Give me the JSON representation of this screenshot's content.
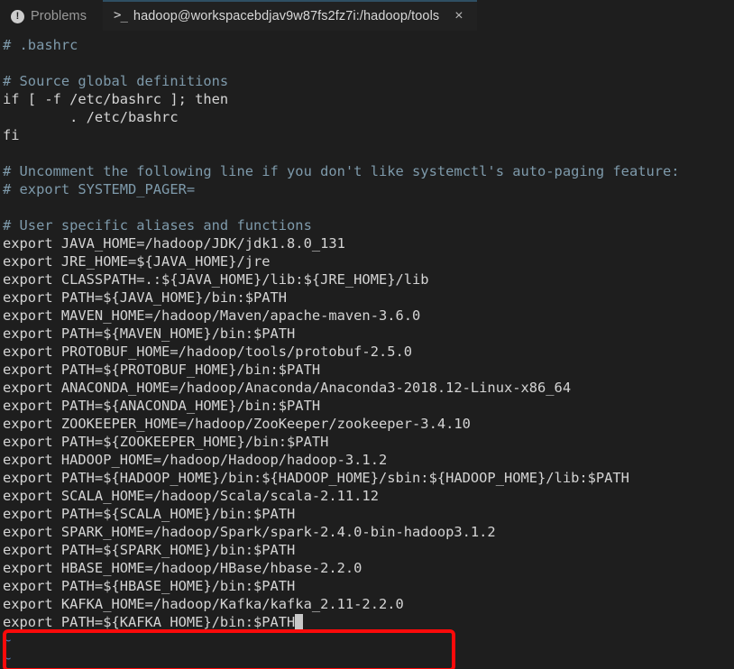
{
  "window": {
    "background_color": "#1e1e1e"
  },
  "panel": {
    "tabs": [
      {
        "id": "problems",
        "label": "Problems",
        "icon": "problem-exclamation-icon",
        "icon_glyph": "!",
        "active": false
      },
      {
        "id": "terminal",
        "label": "hadoop@workspacebdjav9w87fs2fz7i:/hadoop/tools",
        "icon": "terminal-prompt-icon",
        "icon_glyph": ">_",
        "active": true,
        "close_glyph": "×"
      }
    ],
    "active_tab_accent": "#2f4f63"
  },
  "terminal": {
    "editor": "vim",
    "file": ".bashrc",
    "colors": {
      "foreground": "#d4d4d4",
      "comment": "#7e9aab",
      "tilde": "#4f78b5",
      "cursor": "#c8c8c8",
      "background": "#1e1e1e"
    },
    "cursor": {
      "line_index": 30,
      "after_text": "export PATH=${KAFKA_HOME}/bin:$PATH"
    },
    "lines": [
      {
        "text": "# .bashrc",
        "style": "comment"
      },
      {
        "text": "",
        "style": "plain"
      },
      {
        "text": "# Source global definitions",
        "style": "comment"
      },
      {
        "text": "if [ -f /etc/bashrc ]; then",
        "style": "plain"
      },
      {
        "text": "        . /etc/bashrc",
        "style": "plain"
      },
      {
        "text": "fi",
        "style": "plain"
      },
      {
        "text": "",
        "style": "plain"
      },
      {
        "text": "# Uncomment the following line if you don't like systemctl's auto-paging feature:",
        "style": "comment"
      },
      {
        "text": "# export SYSTEMD_PAGER=",
        "style": "comment"
      },
      {
        "text": "",
        "style": "plain"
      },
      {
        "text": "# User specific aliases and functions",
        "style": "comment"
      },
      {
        "text": "export JAVA_HOME=/hadoop/JDK/jdk1.8.0_131",
        "style": "plain"
      },
      {
        "text": "export JRE_HOME=${JAVA_HOME}/jre",
        "style": "plain"
      },
      {
        "text": "export CLASSPATH=.:${JAVA_HOME}/lib:${JRE_HOME}/lib",
        "style": "plain"
      },
      {
        "text": "export PATH=${JAVA_HOME}/bin:$PATH",
        "style": "plain"
      },
      {
        "text": "export MAVEN_HOME=/hadoop/Maven/apache-maven-3.6.0",
        "style": "plain"
      },
      {
        "text": "export PATH=${MAVEN_HOME}/bin:$PATH",
        "style": "plain"
      },
      {
        "text": "export PROTOBUF_HOME=/hadoop/tools/protobuf-2.5.0",
        "style": "plain"
      },
      {
        "text": "export PATH=${PROTOBUF_HOME}/bin:$PATH",
        "style": "plain"
      },
      {
        "text": "export ANACONDA_HOME=/hadoop/Anaconda/Anaconda3-2018.12-Linux-x86_64",
        "style": "plain"
      },
      {
        "text": "export PATH=${ANACONDA_HOME}/bin:$PATH",
        "style": "plain"
      },
      {
        "text": "export ZOOKEEPER_HOME=/hadoop/ZooKeeper/zookeeper-3.4.10",
        "style": "plain"
      },
      {
        "text": "export PATH=${ZOOKEEPER_HOME}/bin:$PATH",
        "style": "plain"
      },
      {
        "text": "export HADOOP_HOME=/hadoop/Hadoop/hadoop-3.1.2",
        "style": "plain"
      },
      {
        "text": "export PATH=${HADOOP_HOME}/bin:${HADOOP_HOME}/sbin:${HADOOP_HOME}/lib:$PATH",
        "style": "plain"
      },
      {
        "text": "export SCALA_HOME=/hadoop/Scala/scala-2.11.12",
        "style": "plain"
      },
      {
        "text": "export PATH=${SCALA_HOME}/bin:$PATH",
        "style": "plain"
      },
      {
        "text": "export SPARK_HOME=/hadoop/Spark/spark-2.4.0-bin-hadoop3.1.2",
        "style": "plain"
      },
      {
        "text": "export PATH=${SPARK_HOME}/bin:$PATH",
        "style": "plain"
      },
      {
        "text": "export HBASE_HOME=/hadoop/HBase/hbase-2.2.0",
        "style": "plain"
      },
      {
        "text": "export PATH=${HBASE_HOME}/bin:$PATH",
        "style": "plain"
      },
      {
        "text": "export KAFKA_HOME=/hadoop/Kafka/kafka_2.11-2.2.0",
        "style": "plain"
      },
      {
        "text": "export PATH=${KAFKA_HOME}/bin:$PATH",
        "style": "plain",
        "cursor": true
      },
      {
        "text": "~",
        "style": "tilde"
      },
      {
        "text": "~",
        "style": "tilde"
      }
    ]
  },
  "annotation": {
    "type": "rectangle-highlight",
    "color": "#fb0a0a",
    "covers_lines": [
      "export KAFKA_HOME=/hadoop/Kafka/kafka_2.11-2.2.0",
      "export PATH=${KAFKA_HOME}/bin:$PATH"
    ]
  }
}
